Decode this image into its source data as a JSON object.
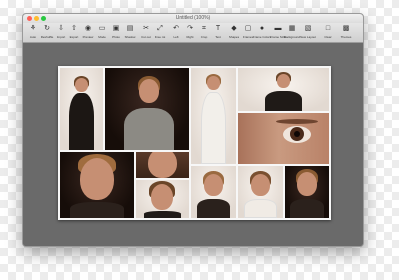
{
  "window": {
    "title": "Untitled (100%)",
    "traffic_lights": [
      "#ff5f57",
      "#febc2e",
      "#28c840"
    ]
  },
  "toolbar": {
    "tools": [
      {
        "label": "Auto",
        "icon": "⚘"
      },
      {
        "label": "Reshuffle",
        "icon": "↻"
      },
      {
        "label": "Import",
        "icon": "⇩"
      },
      {
        "label": "Export",
        "icon": "⇧"
      },
      {
        "label": "Preview",
        "icon": "◉"
      },
      {
        "label": "Mode",
        "icon": "▭"
      },
      {
        "label": "Photo",
        "icon": "▣"
      },
      {
        "label": "Shadow",
        "icon": "▤"
      },
      {
        "label": "Cut out",
        "icon": "✂"
      },
      {
        "label": "Free rot",
        "icon": "⤢"
      },
      {
        "label": "Left",
        "icon": "↶"
      },
      {
        "label": "Right",
        "icon": "↷"
      },
      {
        "label": "Crop",
        "icon": "⌗"
      },
      {
        "label": "Text",
        "icon": "T"
      },
      {
        "label": "Shapes",
        "icon": "◆"
      },
      {
        "label": "Frames",
        "icon": "▢"
      },
      {
        "label": "Frame Colors",
        "icon": "●"
      },
      {
        "label": "Frame Size",
        "icon": "▬"
      },
      {
        "label": "Background",
        "icon": "▦"
      },
      {
        "label": "New Layout",
        "icon": "▧"
      },
      {
        "label": "Clear",
        "icon": "□"
      },
      {
        "label": "Themes",
        "icon": "▩"
      }
    ]
  }
}
